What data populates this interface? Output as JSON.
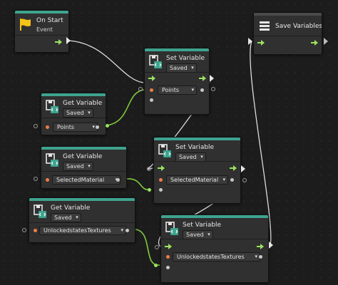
{
  "colors": {
    "accent": "#3ea38f",
    "flow": "#9be25f",
    "value_wire": "#7fc93d",
    "flow_wire": "#dcdcdc",
    "value_port": "#ef7c47"
  },
  "nodes": {
    "on_start": {
      "title": "On Start",
      "subtitle": "Event",
      "icon": "flag-icon"
    },
    "save_variables": {
      "title": "Save Variables",
      "icon": "save-stack-icon"
    },
    "set_var_1": {
      "title": "Set Variable",
      "scope": "Saved",
      "field": "Points",
      "icon": "variable-save-icon"
    },
    "get_var_1": {
      "title": "Get Variable",
      "scope": "Saved",
      "field": "Points",
      "icon": "variable-save-icon"
    },
    "set_var_2": {
      "title": "Set Variable",
      "scope": "Saved",
      "field": "SelectedMaterial",
      "icon": "variable-save-icon"
    },
    "get_var_2": {
      "title": "Get Variable",
      "scope": "Saved",
      "field": "SelectedMaterial",
      "icon": "variable-save-icon"
    },
    "get_var_3": {
      "title": "Get Variable",
      "scope": "Saved",
      "field": "UnlockedstatesTextures",
      "icon": "variable-save-icon"
    },
    "set_var_3": {
      "title": "Set Variable",
      "scope": "Saved",
      "field": "UnlockedstatesTextures",
      "icon": "variable-save-icon"
    }
  }
}
